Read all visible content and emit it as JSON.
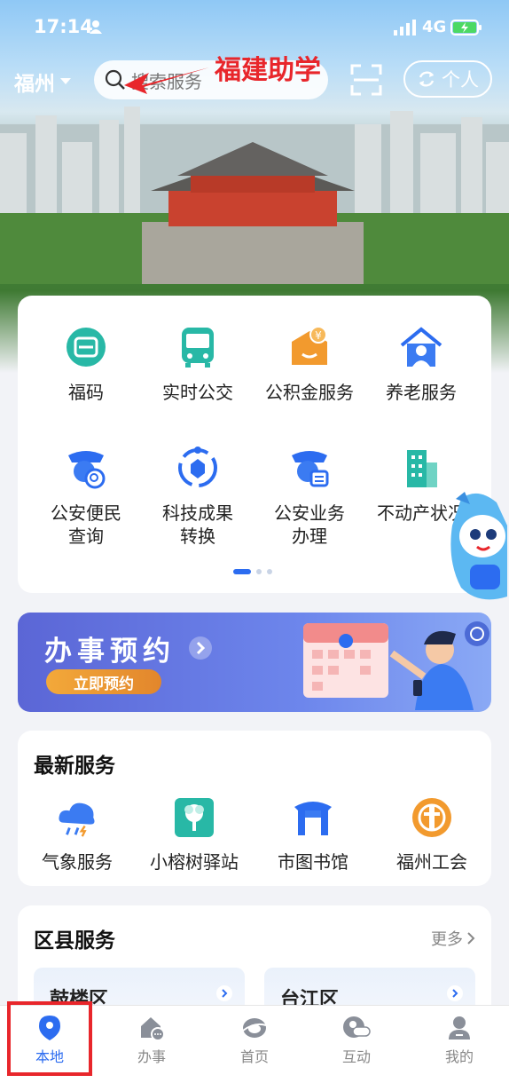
{
  "status_bar": {
    "time": "17:14",
    "network": "4G"
  },
  "header": {
    "city": "福州",
    "search_placeholder": "搜索服务",
    "annotation": "福建助学",
    "personal_label": "个人"
  },
  "grid": [
    {
      "label": "福码",
      "icon": "fu-code-icon"
    },
    {
      "label": "实时公交",
      "icon": "bus-icon"
    },
    {
      "label": "公积金服务",
      "icon": "housing-fund-icon"
    },
    {
      "label": "养老服务",
      "icon": "elderly-care-icon"
    },
    {
      "label": "公安便民\n查询",
      "icon": "police-query-icon"
    },
    {
      "label": "科技成果\n转换",
      "icon": "tech-transfer-icon"
    },
    {
      "label": "公安业务\n办理",
      "icon": "police-business-icon"
    },
    {
      "label": "不动产状况",
      "icon": "real-estate-icon"
    }
  ],
  "banner": {
    "title": "办事预约",
    "button": "立即预约"
  },
  "latest": {
    "title": "最新服务",
    "items": [
      {
        "label": "气象服务",
        "icon": "weather-icon"
      },
      {
        "label": "小榕树驿站",
        "icon": "banyan-icon"
      },
      {
        "label": "市图书馆",
        "icon": "library-icon"
      },
      {
        "label": "福州工会",
        "icon": "union-icon"
      }
    ]
  },
  "district": {
    "title": "区县服务",
    "more": "更多",
    "items": [
      {
        "name": "鼓楼区"
      },
      {
        "name": "台江区"
      }
    ]
  },
  "tabs": [
    {
      "label": "本地",
      "icon": "location-icon"
    },
    {
      "label": "办事",
      "icon": "affairs-icon"
    },
    {
      "label": "首页",
      "icon": "home-icon"
    },
    {
      "label": "互动",
      "icon": "interaction-icon"
    },
    {
      "label": "我的",
      "icon": "profile-icon"
    }
  ],
  "colors": {
    "accent": "#2c6cf0",
    "annotation": "#e8262b",
    "teal": "#28b8a6",
    "orange": "#f29a2e"
  }
}
